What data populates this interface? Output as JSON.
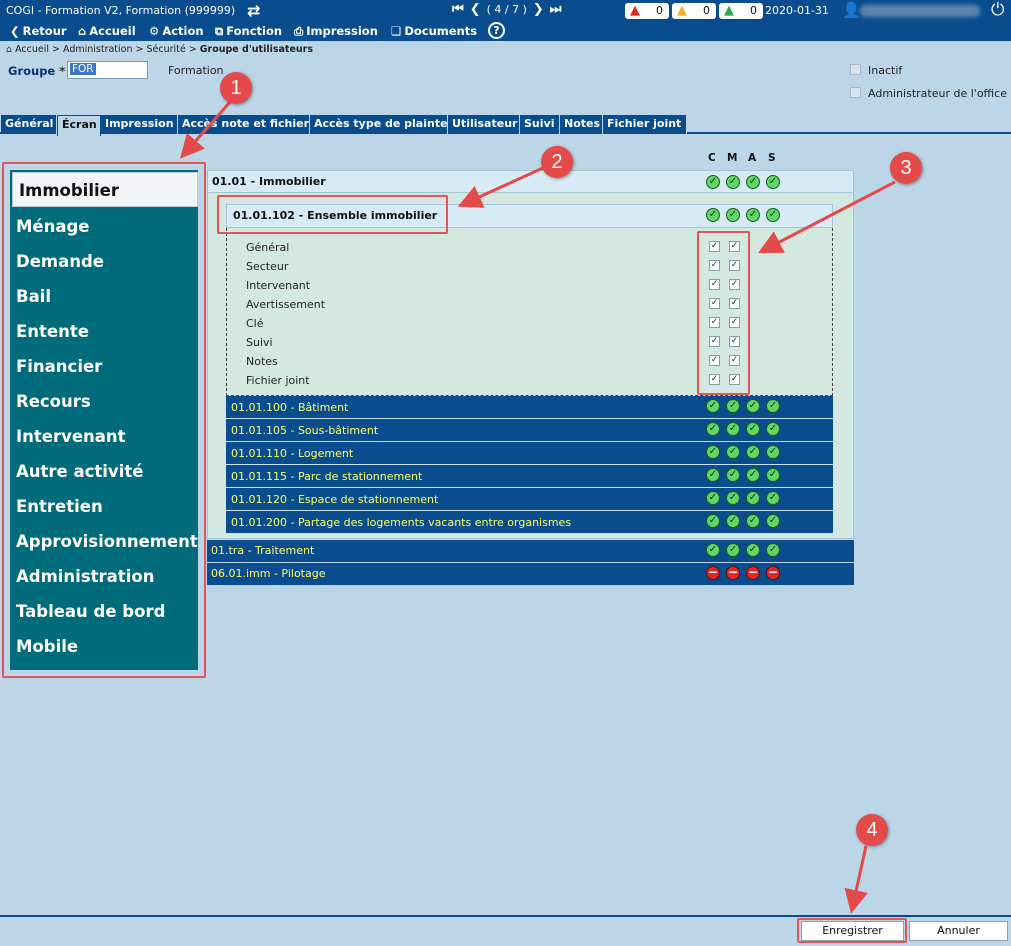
{
  "app": {
    "title": "COGI - Formation V2, Formation (999999)",
    "pager_position": "( 4 / 7 )",
    "date": "2020-01-31",
    "alerts": [
      {
        "color": "#e02828",
        "count": "0"
      },
      {
        "color": "#f2b01e",
        "count": "0"
      },
      {
        "color": "#2aa84a",
        "count": "0"
      }
    ]
  },
  "toolbar": {
    "retour": "Retour",
    "accueil": "Accueil",
    "action": "Action",
    "fonction": "Fonction",
    "impression": "Impression",
    "documents": "Documents"
  },
  "breadcrumb": {
    "path": "Accueil > Administration > Sécurité > ",
    "current": "Groupe d'utilisateurs"
  },
  "form": {
    "groupe_label": "Groupe",
    "required_mark": "*",
    "groupe_value": "FOR",
    "groupe_desc": "Formation",
    "inactif_label": "Inactif",
    "admin_label": "Administrateur de l'office"
  },
  "tabs": [
    "Général",
    "Écran",
    "Impression",
    "Accès note et fichier",
    "Accès type de plainte",
    "Utilisateur",
    "Suivi",
    "Notes",
    "Fichier joint"
  ],
  "left_menu": [
    "Immobilier",
    "Ménage",
    "Demande",
    "Bail",
    "Entente",
    "Financier",
    "Recours",
    "Intervenant",
    "Autre activité",
    "Entretien",
    "Approvisionnement",
    "Administration",
    "Tableau de bord",
    "Mobile"
  ],
  "columns": [
    "C",
    "M",
    "A",
    "S"
  ],
  "tree": {
    "root": {
      "label": "01.01 - Immobilier",
      "status": [
        "ok",
        "ok",
        "ok",
        "ok"
      ]
    },
    "expanded": {
      "label": "01.01.102 - Ensemble immobilier",
      "status": [
        "ok",
        "ok",
        "ok",
        "ok"
      ]
    },
    "details": [
      {
        "label": "Général",
        "checks": [
          true,
          true
        ]
      },
      {
        "label": "Secteur",
        "checks": [
          true,
          true
        ]
      },
      {
        "label": "Intervenant",
        "checks": [
          true,
          true
        ]
      },
      {
        "label": "Avertissement",
        "checks": [
          true,
          true
        ]
      },
      {
        "label": "Clé",
        "checks": [
          true,
          true
        ]
      },
      {
        "label": "Suivi",
        "checks": [
          true,
          true
        ]
      },
      {
        "label": "Notes",
        "checks": [
          true,
          true
        ]
      },
      {
        "label": "Fichier joint",
        "checks": [
          true,
          true
        ]
      }
    ],
    "sub_items": [
      {
        "label": "01.01.100 - Bâtiment",
        "status": [
          "ok",
          "ok",
          "ok",
          "ok"
        ]
      },
      {
        "label": "01.01.105 - Sous-bâtiment",
        "status": [
          "ok",
          "ok",
          "ok",
          "ok"
        ]
      },
      {
        "label": "01.01.110 - Logement",
        "status": [
          "ok",
          "ok",
          "ok",
          "ok"
        ]
      },
      {
        "label": "01.01.115 - Parc de stationnement",
        "status": [
          "ok",
          "ok",
          "ok",
          "ok"
        ]
      },
      {
        "label": "01.01.120 - Espace de stationnement",
        "status": [
          "ok",
          "ok",
          "ok",
          "ok"
        ]
      },
      {
        "label": "01.01.200 - Partage des logements vacants entre organismes",
        "status": [
          "ok",
          "ok",
          "ok",
          "ok"
        ]
      }
    ],
    "siblings": [
      {
        "label": "01.tra - Traitement",
        "status": [
          "ok",
          "ok",
          "ok",
          "ok"
        ]
      },
      {
        "label": "06.01.imm - Pilotage",
        "status": [
          "deny",
          "deny",
          "deny",
          "deny"
        ]
      }
    ]
  },
  "callouts": [
    "1",
    "2",
    "3",
    "4"
  ],
  "buttons": {
    "save": "Enregistrer",
    "cancel": "Annuler"
  }
}
